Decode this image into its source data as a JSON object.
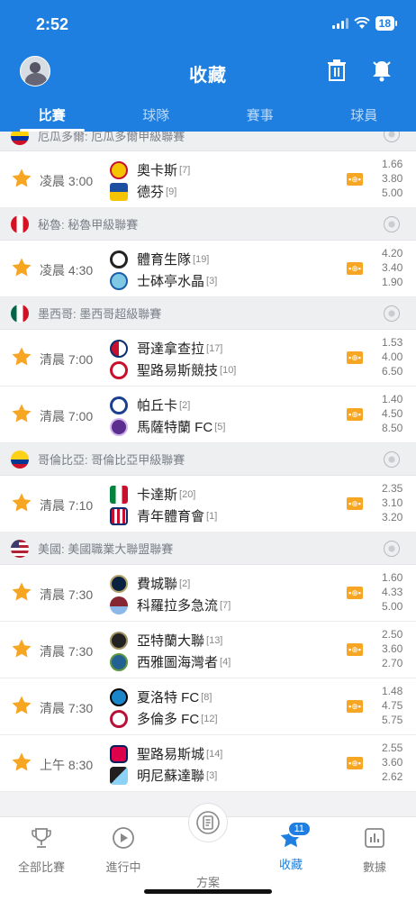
{
  "status": {
    "time": "2:52",
    "battery": "18"
  },
  "header": {
    "title": "收藏"
  },
  "tabs": [
    {
      "label": "比賽",
      "active": true
    },
    {
      "label": "球隊",
      "active": false
    },
    {
      "label": "賽事",
      "active": false
    },
    {
      "label": "球員",
      "active": false
    }
  ],
  "leagues": [
    {
      "name": "厄瓜多爾: 厄瓜多爾甲級聯賽",
      "flag": "ecuador",
      "matches": [
        {
          "time": "凌晨 3:00",
          "home": "奧卡斯",
          "home_rank": "[7]",
          "away": "德芬",
          "away_rank": "[9]",
          "odds": [
            "1.66",
            "3.80",
            "5.00"
          ]
        }
      ]
    },
    {
      "name": "秘魯: 秘魯甲級聯賽",
      "flag": "peru",
      "matches": [
        {
          "time": "凌晨 4:30",
          "home": "體育生隊",
          "home_rank": "[19]",
          "away": "士砵亭水晶",
          "away_rank": "[3]",
          "odds": [
            "4.20",
            "3.40",
            "1.90"
          ]
        }
      ]
    },
    {
      "name": "墨西哥: 墨西哥超級聯賽",
      "flag": "mexico",
      "matches": [
        {
          "time": "清晨 7:00",
          "home": "哥達拿查拉",
          "home_rank": "[17]",
          "away": "聖路易斯競技",
          "away_rank": "[10]",
          "odds": [
            "1.53",
            "4.00",
            "6.50"
          ]
        },
        {
          "time": "清晨 7:00",
          "home": "帕丘卡",
          "home_rank": "[2]",
          "away": "馬薩特蘭 FC",
          "away_rank": "[5]",
          "odds": [
            "1.40",
            "4.50",
            "8.50"
          ]
        }
      ]
    },
    {
      "name": "哥倫比亞: 哥倫比亞甲級聯賽",
      "flag": "colombia",
      "matches": [
        {
          "time": "清晨 7:10",
          "home": "卡達斯",
          "home_rank": "[20]",
          "away": "青年體育會",
          "away_rank": "[1]",
          "odds": [
            "2.35",
            "3.10",
            "3.20"
          ]
        }
      ]
    },
    {
      "name": "美國: 美國職業大聯盟聯賽",
      "flag": "usa",
      "matches": [
        {
          "time": "清晨 7:30",
          "home": "費城聯",
          "home_rank": "[2]",
          "away": "科羅拉多急流",
          "away_rank": "[7]",
          "odds": [
            "1.60",
            "4.33",
            "5.00"
          ]
        },
        {
          "time": "清晨 7:30",
          "home": "亞特蘭大聯",
          "home_rank": "[13]",
          "away": "西雅圖海灣者",
          "away_rank": "[4]",
          "odds": [
            "2.50",
            "3.60",
            "2.70"
          ]
        },
        {
          "time": "清晨 7:30",
          "home": "夏洛特 FC",
          "home_rank": "[8]",
          "away": "多倫多 FC",
          "away_rank": "[12]",
          "odds": [
            "1.48",
            "4.75",
            "5.75"
          ]
        },
        {
          "time": "上午 8:30",
          "home": "聖路易斯城",
          "home_rank": "[14]",
          "away": "明尼蘇達聯",
          "away_rank": "[3]",
          "odds": [
            "2.55",
            "3.60",
            "2.62"
          ]
        }
      ]
    }
  ],
  "bottom_nav": [
    {
      "label": "全部比賽",
      "icon": "trophy-icon",
      "active": false
    },
    {
      "label": "進行中",
      "icon": "play-icon",
      "active": false
    },
    {
      "label": "方案",
      "icon": "plan-icon",
      "active": false
    },
    {
      "label": "收藏",
      "icon": "star-icon",
      "active": true,
      "badge": "11"
    },
    {
      "label": "數據",
      "icon": "stats-icon",
      "active": false
    }
  ],
  "colors": {
    "brand": "#1e7fe0",
    "star": "#f6a623"
  }
}
